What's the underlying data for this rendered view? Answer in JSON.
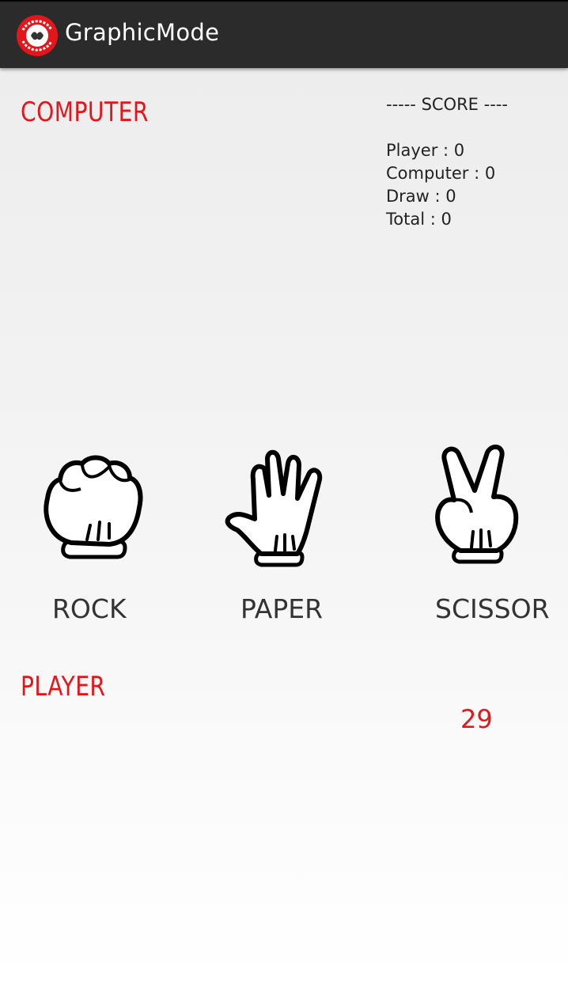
{
  "app": {
    "title": "GraphicMode",
    "icon": "rock-paper-scissors-logo-icon",
    "icon_text": "ROCK PAPER SCISSORS",
    "accent_color": "#e3161b",
    "actionbar_color": "#2b2b2b"
  },
  "computer": {
    "title": "COMPUTER"
  },
  "score": {
    "header": "----- SCORE ----",
    "lines": [
      "Player : 0",
      "Computer : 0",
      "Draw : 0",
      "Total : 0"
    ]
  },
  "choices": [
    {
      "label": "ROCK",
      "icon": "rock-hand-icon"
    },
    {
      "label": "PAPER",
      "icon": "paper-hand-icon"
    },
    {
      "label": "SCISSOR",
      "icon": "scissor-hand-icon"
    }
  ],
  "player": {
    "title": "PLAYER"
  },
  "timer": {
    "value": "29"
  }
}
